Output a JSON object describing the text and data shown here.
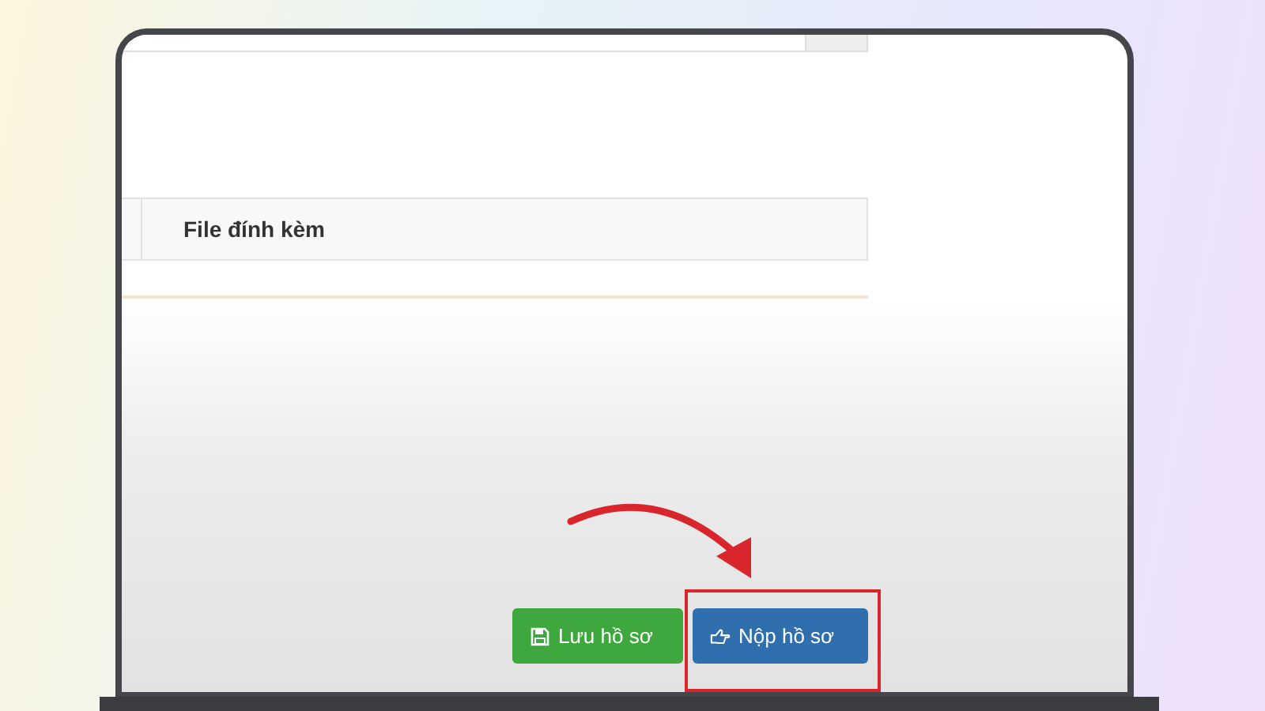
{
  "table": {
    "columns": [
      {
        "label": "File đính kèm"
      }
    ]
  },
  "buttons": [
    {
      "label": "Lưu hồ sơ",
      "kind": "save",
      "highlighted": false
    },
    {
      "label": "Nộp hồ sơ",
      "kind": "submit",
      "highlighted": true
    }
  ]
}
